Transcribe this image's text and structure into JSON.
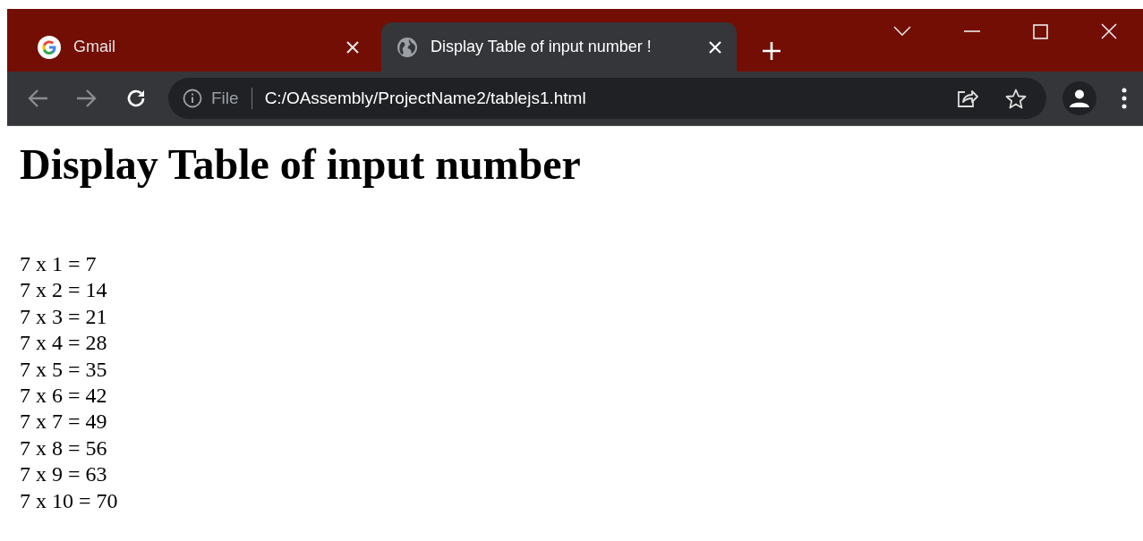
{
  "tabs": [
    {
      "title": "Gmail",
      "selected": false,
      "kind": "google"
    },
    {
      "title": "Display Table of input number !",
      "selected": true,
      "kind": "globe"
    }
  ],
  "address_bar": {
    "scheme": "File",
    "url": "C:/OAssembly/ProjectName2/tablejs1.html"
  },
  "page": {
    "heading": "Display Table of input number",
    "lines": [
      "7 x 1 = 7",
      "7 x 2 = 14",
      "7 x 3 = 21",
      "7 x 4 = 28",
      "7 x 5 = 35",
      "7 x 6 = 42",
      "7 x 7 = 49",
      "7 x 8 = 56",
      "7 x 9 = 63",
      "7 x 10 = 70"
    ]
  }
}
